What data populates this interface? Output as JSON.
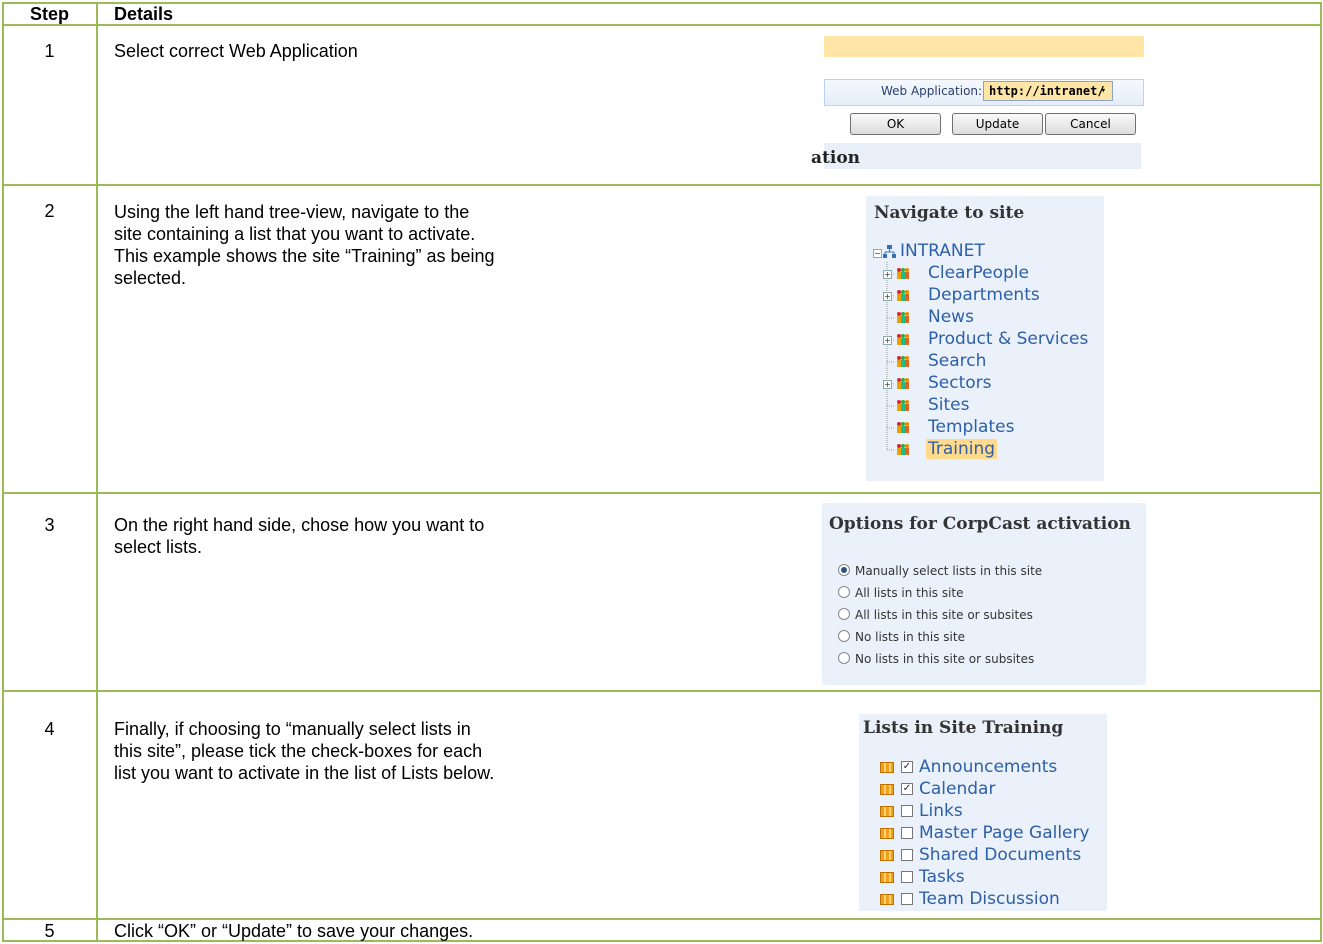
{
  "table": {
    "headers": [
      "Step",
      "Details"
    ],
    "rows": [
      {
        "step": "1",
        "lines": [
          "Select correct Web Application"
        ]
      },
      {
        "step": "2",
        "lines": [
          "Using the left hand tree-view, navigate to the",
          "site containing a list that you want to activate.",
          "This example shows the site “Training” as being",
          "selected."
        ]
      },
      {
        "step": "3",
        "lines": [
          "On the right hand side, chose how you want to",
          "select lists."
        ]
      },
      {
        "step": "4",
        "lines": [
          "Finally, if choosing to “manually select lists in",
          "this site”, please tick the check-boxes for each",
          "list you want to activate in the list of Lists below."
        ]
      },
      {
        "step": "5",
        "lines": [
          "Click “OK” or “Update” to save your changes."
        ]
      }
    ]
  },
  "shot1": {
    "web_app_label": "Web Application:",
    "web_app_value": "http://intranet/",
    "dropdown_arrow": "▾",
    "buttons": [
      "OK",
      "Update",
      "Cancel"
    ],
    "section_fragment": "ation"
  },
  "shot2": {
    "heading": "Navigate to site",
    "root": "INTRANET",
    "items": [
      {
        "label": "ClearPeople",
        "expandable": true
      },
      {
        "label": "Departments",
        "expandable": true
      },
      {
        "label": "News",
        "expandable": false
      },
      {
        "label": "Product & Services",
        "expandable": true
      },
      {
        "label": "Search",
        "expandable": false
      },
      {
        "label": "Sectors",
        "expandable": true
      },
      {
        "label": "Sites",
        "expandable": false
      },
      {
        "label": "Templates",
        "expandable": false
      },
      {
        "label": "Training",
        "expandable": false,
        "selected": true
      }
    ]
  },
  "shot3": {
    "heading": "Options for CorpCast activation",
    "options": [
      {
        "label": "Manually select lists in this site",
        "selected": true
      },
      {
        "label": "All lists in this site",
        "selected": false
      },
      {
        "label": "All lists in this site or subsites",
        "selected": false
      },
      {
        "label": "No lists in this site",
        "selected": false
      },
      {
        "label": "No lists in this site or subsites",
        "selected": false
      }
    ]
  },
  "shot4": {
    "heading": "Lists in Site Training",
    "lists": [
      {
        "label": "Announcements",
        "checked": true
      },
      {
        "label": "Calendar",
        "checked": true
      },
      {
        "label": "Links",
        "checked": false
      },
      {
        "label": "Master Page Gallery",
        "checked": false
      },
      {
        "label": "Shared Documents",
        "checked": false
      },
      {
        "label": "Tasks",
        "checked": false
      },
      {
        "label": "Team Discussion",
        "checked": false
      }
    ]
  },
  "colors": {
    "table_border": "#9BBB59",
    "highlight": "#FFE5A6",
    "panel_bg": "#EAF1FB",
    "link": "#2D5FA8"
  },
  "icons": {
    "tree_root": "network-icon",
    "tree_site": "site-people-icon",
    "list_item": "list-icon",
    "expand": "plus-icon",
    "collapse": "minus-icon"
  }
}
